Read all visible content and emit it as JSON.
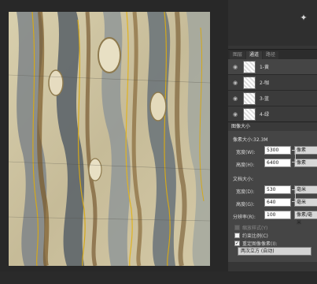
{
  "toolbar": {
    "tool_icon": "lightbulb-icon"
  },
  "layers_panel": {
    "tabs": [
      "图层",
      "通道",
      "路径"
    ],
    "active_tab": 1,
    "layers": [
      {
        "name": "1-黄",
        "selected": true
      },
      {
        "name": "2-咖",
        "selected": false
      },
      {
        "name": "3-蓝",
        "selected": false
      },
      {
        "name": "4-绿",
        "selected": false
      }
    ]
  },
  "dialog": {
    "title": "图像大小",
    "pixel_dimensions": "像素大小:32.3M",
    "width_label": "宽度(W):",
    "width_value": "5300",
    "width_unit": "像素",
    "height_label": "高度(H):",
    "height_value": "6400",
    "height_unit": "像素",
    "document_size": "文档大小:",
    "doc_width_label": "宽度(D):",
    "doc_width_value": "530",
    "doc_width_unit": "毫米",
    "doc_height_label": "高度(G):",
    "doc_height_value": "640",
    "doc_height_unit": "毫米",
    "resolution_label": "分辨率(R):",
    "resolution_value": "100",
    "resolution_unit": "像素/毫米",
    "scale_styles": "缩放样式(Y)",
    "constrain": "约束比例(C)",
    "resample": "重定图像像素(I):",
    "resample_method": "两次立方 (自动)"
  }
}
